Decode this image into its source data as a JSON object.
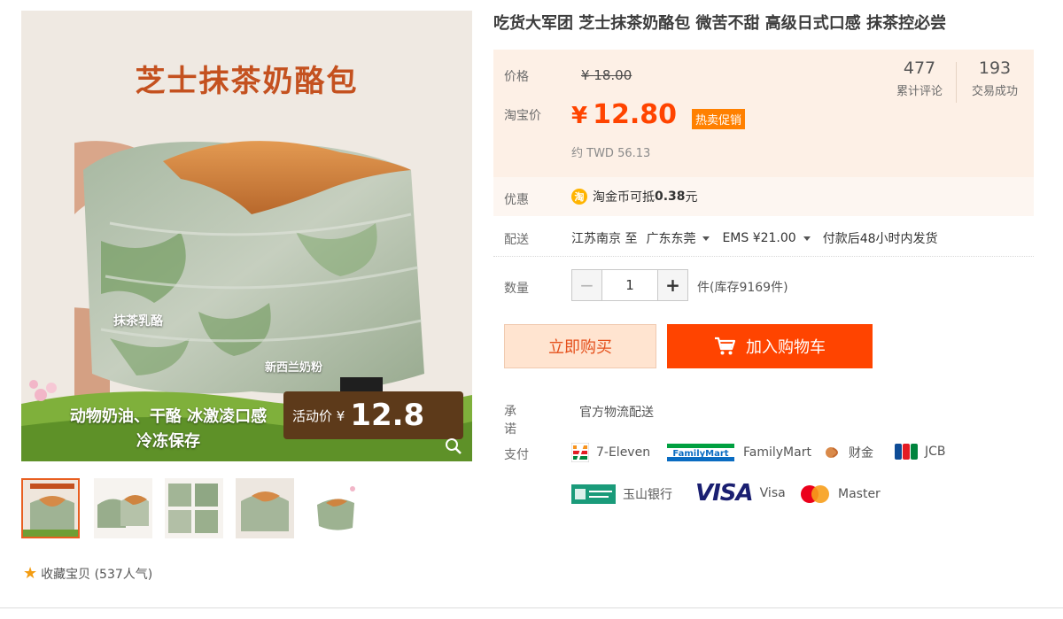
{
  "product": {
    "title": "吃货大军团 芝士抹茶奶酪包 微苦不甜 高级日式口感 抹茶控必尝"
  },
  "gallery": {
    "main_image": {
      "banner_title": "芝士抹茶奶酪包",
      "tag_matcha": "抹茶乳酪",
      "tag_milk": "新西兰奶粉",
      "feature_line1": "动物奶油、干酪 冰激凌口感",
      "feature_line2": "冷冻保存",
      "promo_label": "活动价 ¥",
      "promo_value": "12.8",
      "zoom_icon": "magnifier-icon"
    },
    "thumbnails": [
      {
        "label": "thumbnail-1",
        "active": true
      },
      {
        "label": "thumbnail-2",
        "active": false
      },
      {
        "label": "thumbnail-3",
        "active": false
      },
      {
        "label": "thumbnail-4",
        "active": false
      },
      {
        "label": "thumbnail-5",
        "active": false
      }
    ],
    "favorite": {
      "icon": "star-icon",
      "label": "收藏宝贝 (537人气)"
    }
  },
  "price": {
    "orig_label": "价格",
    "orig_price": "¥ 18.00",
    "taobao_label": "淘宝价",
    "currency": "¥",
    "price": "12.80",
    "badge": "热卖促销",
    "twd": "约 TWD 56.13",
    "reviews_count": "477",
    "reviews_label": "累计评论",
    "deals_count": "193",
    "deals_label": "交易成功"
  },
  "coupon": {
    "label": "优惠",
    "coin_text": "淘",
    "text_prefix": "淘金币可抵",
    "amount": "0.38",
    "unit": "元"
  },
  "shipping": {
    "label": "配送",
    "from": "江苏南京 至",
    "to": "广东东莞",
    "method": "EMS ¥21.00",
    "dispatch": "付款后48小时内发货"
  },
  "quantity": {
    "label": "数量",
    "value": "1",
    "minus": "−",
    "plus": "+",
    "stock": "件(库存9169件)"
  },
  "actions": {
    "buy_now": "立即购买",
    "add_to_cart": "加入购物车"
  },
  "promise": {
    "label": "承诺",
    "value": "官方物流配送"
  },
  "payment": {
    "label": "支付",
    "methods": [
      "7-Eleven",
      "FamilyMart",
      "财金",
      "JCB",
      "玉山银行",
      "Visa",
      "Master"
    ],
    "visa_logo_text": "VISA",
    "fm_logo_text": "FamilyMart"
  },
  "colors": {
    "accent": "#ff4400",
    "price_panel_bg": "#fdf0e6",
    "buy_now_bg": "#ffe4d0"
  }
}
